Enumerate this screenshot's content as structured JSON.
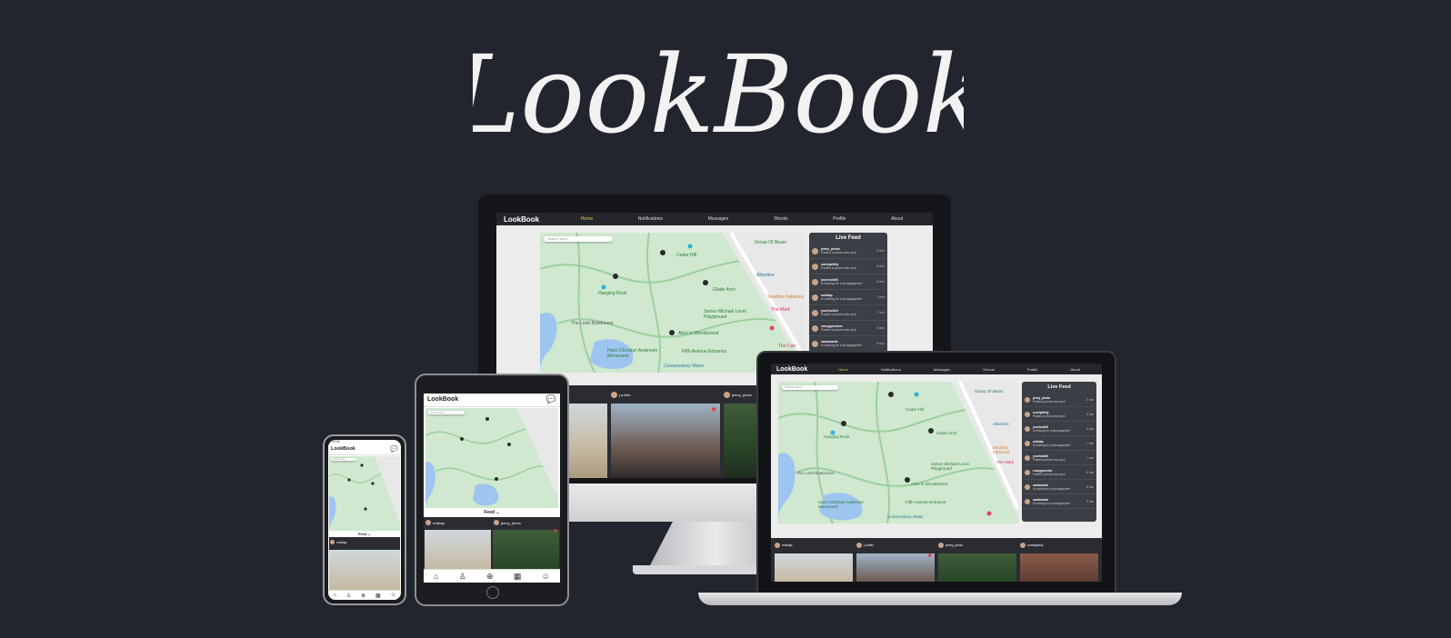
{
  "app": {
    "logo_text": "LookBook",
    "brand": "LookBook"
  },
  "nav": {
    "links": [
      "Home",
      "Notifications",
      "Messages",
      "Shoots",
      "Profile",
      "About"
    ],
    "active": "Home"
  },
  "map": {
    "search_placeholder": "Search area",
    "labels": [
      "Cedar Hill",
      "Group Of Bears",
      "Hanging Rock",
      "Glade Arch",
      "Albertine",
      "Serafina Fabulous",
      "The Mark",
      "James Michael Levin Playground",
      "The Loeb Boathouse",
      "Alice in Wonderland",
      "Hans Christian Andersen Monument",
      "Fifth Avenue Entrance",
      "Conservatory Water",
      "The Carl",
      "5-star hotel"
    ]
  },
  "live_feed": {
    "title": "Live Feed",
    "items": [
      {
        "user": "jenny_photo",
        "msg": "Posted a photo near you!",
        "time": "5 min"
      },
      {
        "user": "surelyafeliy",
        "msg": "Posted a photo near you!",
        "time": "6 min"
      },
      {
        "user": "yourlocibill",
        "msg": "Is looking for a photographer!",
        "time": "6 min"
      },
      {
        "user": "nufstap",
        "msg": "Is looking for a photographer!",
        "time": "7 min"
      },
      {
        "user": "yourlocibill",
        "msg": "Posted a photo near you!",
        "time": "7 min"
      },
      {
        "user": "crazygonedoe",
        "msg": "Posted a photo near you!",
        "time": "8 min"
      },
      {
        "user": "sarahsarah",
        "msg": "Is looking for a photographer!",
        "time": "8 min"
      },
      {
        "user": "sarahsarah",
        "msg": "Is looking for a photographer!",
        "time": "9 min"
      }
    ]
  },
  "cards": [
    {
      "user": "nufstap",
      "stars": "★★★★★"
    },
    {
      "user": "j.a.felix",
      "stars": "★★★★★"
    },
    {
      "user": "jenny_photo",
      "stars": "★★★★★"
    },
    {
      "user": "surelyafeliy",
      "stars": "★★★★★"
    }
  ],
  "mobile": {
    "feed_toggle": "Feed ⌄",
    "status_time": "12:34"
  },
  "tab_icons": [
    "home-icon",
    "shoots-icon",
    "add-icon",
    "calendar-icon",
    "profile-icon"
  ],
  "colors": {
    "bg": "#22252d",
    "nav": "#24262c",
    "accent": "#f0c85a",
    "heart": "#e43b4e",
    "map": "#cfe8cf"
  }
}
